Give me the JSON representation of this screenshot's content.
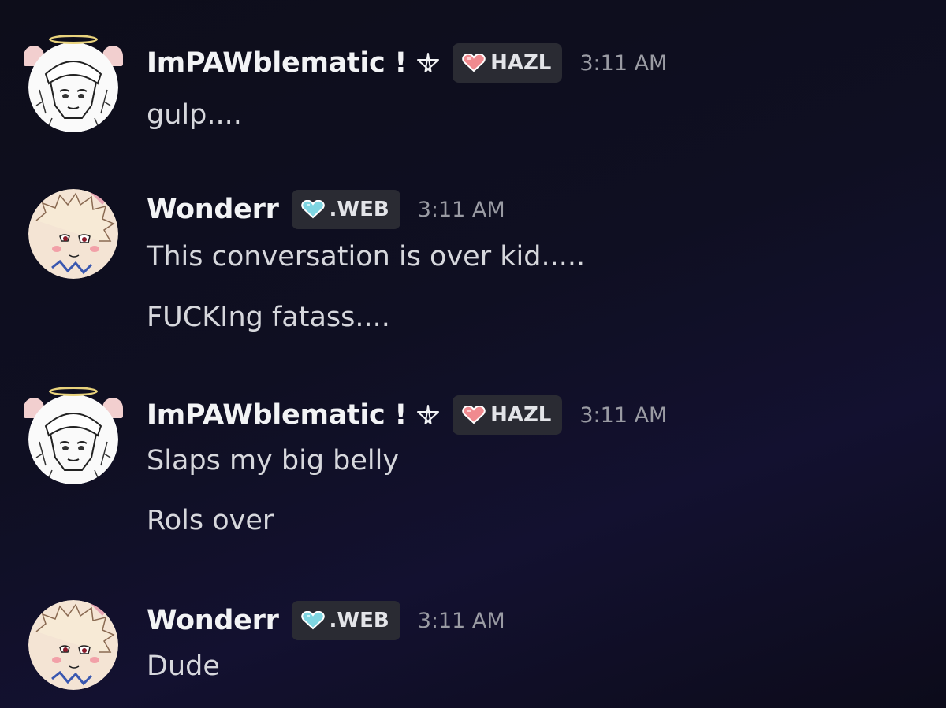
{
  "colors": {
    "background": "#0f0f22",
    "username": "#f2f3f5",
    "message_text": "#d6d7dc",
    "timestamp": "#9a9ba3",
    "tag_bg": "#2a2b33",
    "hazl_heart": "#f08a8f",
    "web_heart": "#7fd6e2",
    "halo": "#e8d27c"
  },
  "messages": [
    {
      "username": "ImPAWblematic !",
      "user_symbol_icon": "pentagram-icon",
      "tag": {
        "icon": "pink-heart-icon",
        "label": "HAZL"
      },
      "timestamp": "3:11 AM",
      "lines": [
        "gulp...."
      ]
    },
    {
      "username": "Wonderr",
      "tag": {
        "icon": "cyan-heart-icon",
        "label": ".WEB"
      },
      "timestamp": "3:11 AM",
      "lines": [
        "This conversation is over kid.....",
        "FUCKIng fatass...."
      ]
    },
    {
      "username": "ImPAWblematic !",
      "user_symbol_icon": "pentagram-icon",
      "tag": {
        "icon": "pink-heart-icon",
        "label": "HAZL"
      },
      "timestamp": "3:11 AM",
      "lines": [
        "Slaps my big belly",
        "Rols over"
      ]
    },
    {
      "username": "Wonderr",
      "tag": {
        "icon": "cyan-heart-icon",
        "label": ".WEB"
      },
      "timestamp": "3:11 AM",
      "lines": [
        "Dude"
      ]
    }
  ]
}
